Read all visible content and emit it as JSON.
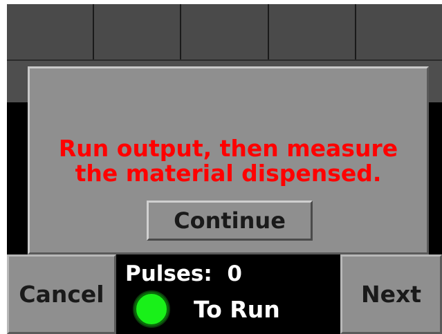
{
  "dialog": {
    "message_line1": "Run output, then measure",
    "message_line2": "the material dispensed.",
    "continue_label": "Continue",
    "message_color": "#ff0000"
  },
  "bottom_bar": {
    "cancel_label": "Cancel",
    "next_label": "Next",
    "pulses_label": "Pulses:",
    "pulses_value": "0",
    "run_status": "To Run",
    "indicator_icon": "green-led",
    "indicator_color": "#19f019"
  }
}
